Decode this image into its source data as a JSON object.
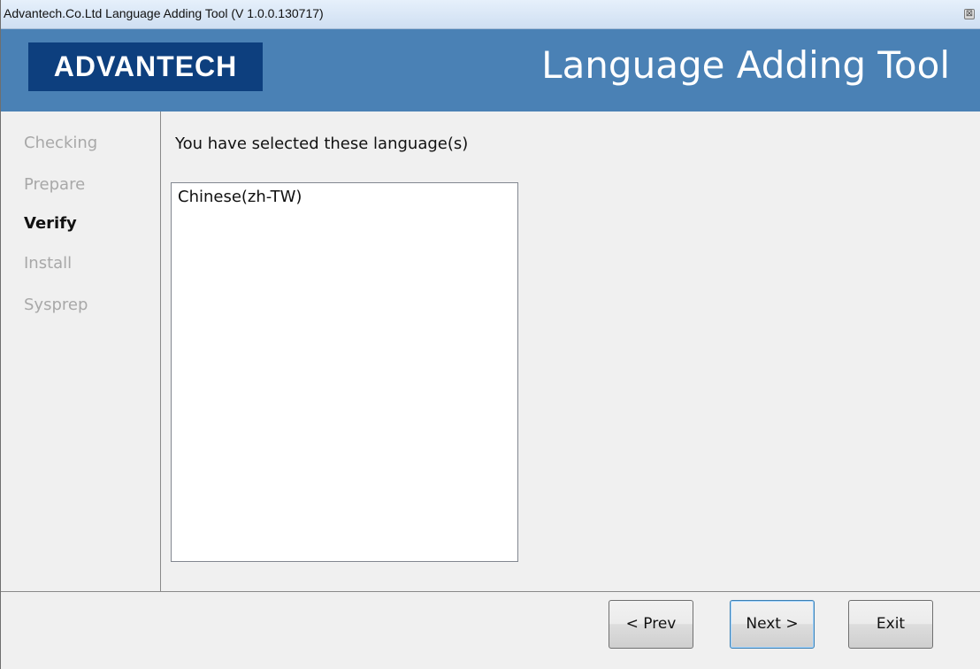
{
  "window": {
    "title": "Advantech.Co.Ltd Language Adding Tool (V 1.0.0.130717)",
    "close_glyph": "⊠"
  },
  "banner": {
    "logo_text": "ADVANTECH",
    "title": "Language Adding Tool"
  },
  "steps": [
    {
      "label": "Checking",
      "active": false
    },
    {
      "label": "Prepare",
      "active": false
    },
    {
      "label": "Verify",
      "active": true
    },
    {
      "label": "Install",
      "active": false
    },
    {
      "label": "Sysprep",
      "active": false
    }
  ],
  "main": {
    "label": "You have selected these language(s)",
    "languages": [
      "Chinese(zh-TW)"
    ]
  },
  "buttons": {
    "prev": "< Prev",
    "next": "Next >",
    "exit": "Exit"
  },
  "colors": {
    "banner": "#4a81b5",
    "logo_bg": "#0d3f7e",
    "inactive_step": "#a8a8a8"
  }
}
